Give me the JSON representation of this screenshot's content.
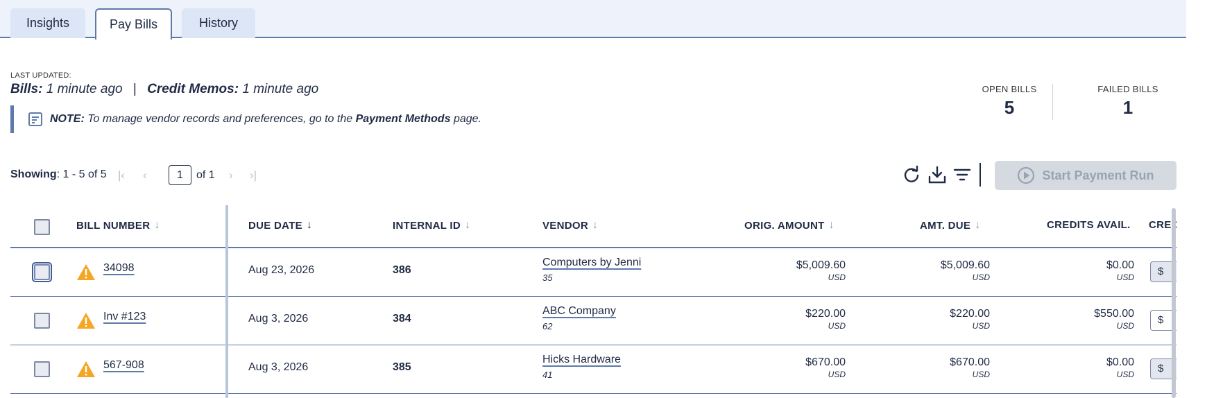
{
  "tabs": [
    {
      "label": "Insights",
      "active": false
    },
    {
      "label": "Pay Bills",
      "active": true
    },
    {
      "label": "History",
      "active": false
    }
  ],
  "last_updated": {
    "caption": "LAST UPDATED:",
    "bills_label": "Bills:",
    "bills_value": "1 minute ago",
    "separator": "|",
    "memos_label": "Credit Memos:",
    "memos_value": "1 minute ago"
  },
  "note": {
    "label": "NOTE:",
    "text_before": "To manage vendor records and preferences, go to the",
    "link": "Payment Methods",
    "text_after": "page."
  },
  "stats": {
    "open_label": "OPEN BILLS",
    "open_value": "5",
    "failed_label": "FAILED BILLS",
    "failed_value": "1"
  },
  "pager": {
    "showing_label": "Showing",
    "showing_range": ": 1 - 5 of 5",
    "page": "1",
    "of_label": "of 1"
  },
  "toolbar": {
    "icons": [
      "refresh-icon",
      "download-icon",
      "filter-icon"
    ],
    "start_label": "Start Payment Run"
  },
  "table": {
    "columns": [
      "BILL NUMBER",
      "DUE DATE",
      "INTERNAL ID",
      "VENDOR",
      "ORIG. AMOUNT",
      "AMT. DUE",
      "CREDITS AVAIL.",
      "CRED"
    ],
    "rows": [
      {
        "bill": "34098",
        "due": "Aug 23, 2026",
        "internal_id": "386",
        "vendor": "Computers by Jenni",
        "vendor_id": "35",
        "orig": "$5,009.60",
        "orig_cur": "USD",
        "due_amt": "$5,009.60",
        "due_cur": "USD",
        "credits": "$0.00",
        "credits_cur": "USD",
        "credit_in": "$"
      },
      {
        "bill": "Inv #123",
        "due": "Aug 3, 2026",
        "internal_id": "384",
        "vendor": "ABC Company",
        "vendor_id": "62",
        "orig": "$220.00",
        "orig_cur": "USD",
        "due_amt": "$220.00",
        "due_cur": "USD",
        "credits": "$550.00",
        "credits_cur": "USD",
        "credit_in": "$"
      },
      {
        "bill": "567-908",
        "due": "Aug 3, 2026",
        "internal_id": "385",
        "vendor": "Hicks Hardware",
        "vendor_id": "41",
        "orig": "$670.00",
        "orig_cur": "USD",
        "due_amt": "$670.00",
        "due_cur": "USD",
        "credits": "$0.00",
        "credits_cur": "USD",
        "credit_in": "$"
      }
    ]
  },
  "colors": {
    "accent": "#5d7aaa",
    "text": "#1f2a44",
    "warning": "#f5a623",
    "disabled": "#d5d9e0"
  }
}
